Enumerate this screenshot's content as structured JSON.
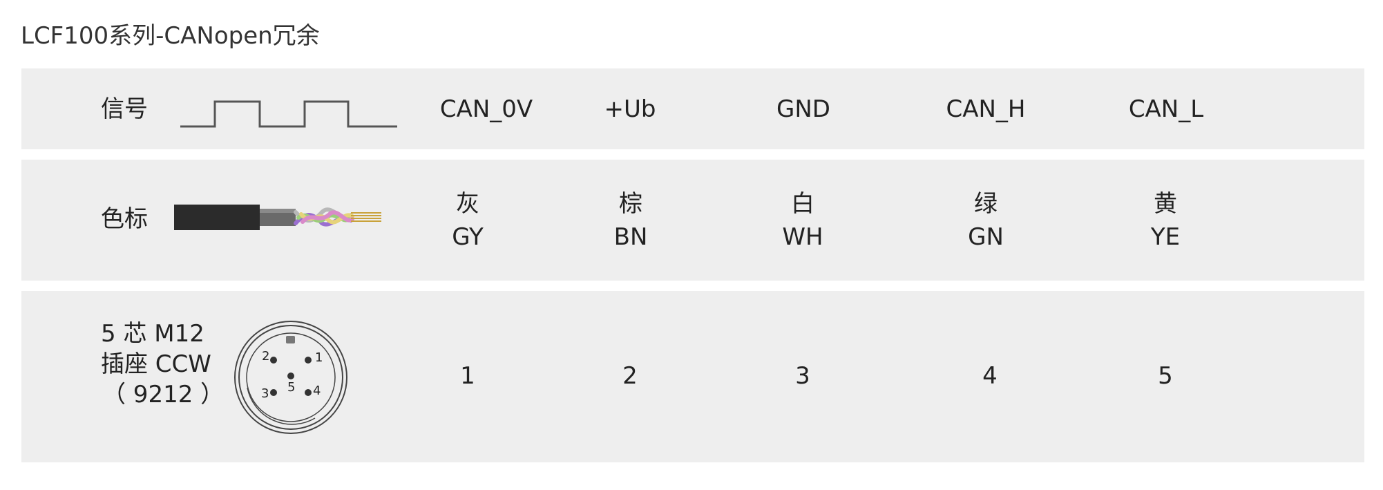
{
  "title": "LCF100系列-CANopen冗余",
  "rows": {
    "signal": {
      "label": "信号",
      "values": [
        "CAN_0V",
        "+Ub",
        "GND",
        "CAN_H",
        "CAN_L"
      ]
    },
    "color": {
      "label": "色标",
      "values": [
        {
          "cn": "灰",
          "code": "GY"
        },
        {
          "cn": "棕",
          "code": "BN"
        },
        {
          "cn": "白",
          "code": "WH"
        },
        {
          "cn": "绿",
          "code": "GN"
        },
        {
          "cn": "黄",
          "code": "YE"
        }
      ],
      "wire_colors": [
        "#b8b8b8",
        "#9a6fd0",
        "#9ccf7a",
        "#e6d37a",
        "#d98ac9"
      ]
    },
    "pin": {
      "label_lines": [
        "5 芯 M12",
        "插座 CCW",
        "（ 9212 ）"
      ],
      "values": [
        "1",
        "2",
        "3",
        "4",
        "5"
      ],
      "connector_pins": [
        "1",
        "2",
        "3",
        "4",
        "5"
      ]
    }
  },
  "colors": {
    "row_bg": "#eeeeee",
    "text": "#222222",
    "waveform": "#555555"
  },
  "icons": {
    "signal": "square-wave-icon",
    "color": "multicore-cable-icon",
    "pin": "m12-connector-icon"
  }
}
